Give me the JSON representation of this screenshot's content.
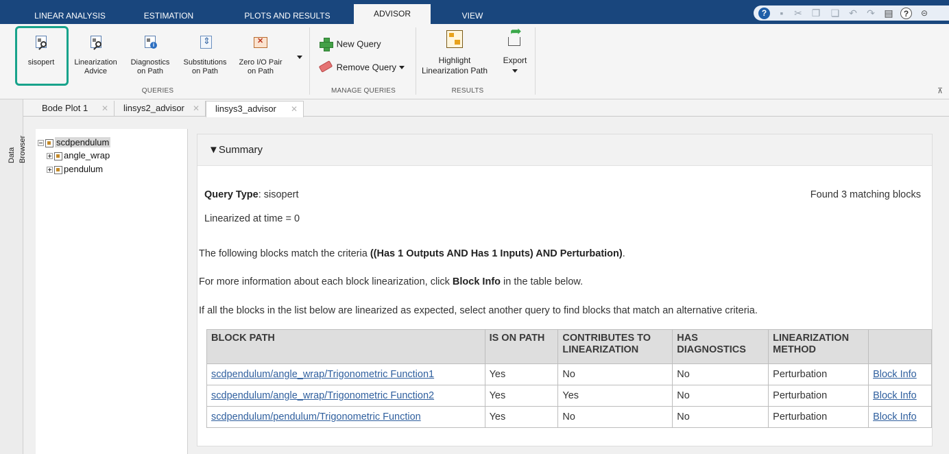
{
  "tabs": [
    {
      "label": "LINEAR ANALYSIS",
      "active": false
    },
    {
      "label": "ESTIMATION",
      "active": false
    },
    {
      "label": "PLOTS AND RESULTS",
      "active": false
    },
    {
      "label": "ADVISOR",
      "active": true
    },
    {
      "label": "VIEW",
      "active": false
    }
  ],
  "quick_access": [
    "help-icon",
    "save-icon",
    "cut-icon",
    "copy-icon",
    "paste-icon",
    "undo-icon",
    "redo-icon",
    "layout-icon",
    "help-icon",
    "minimize-icon"
  ],
  "ribbon": {
    "queries": {
      "buttons": [
        {
          "line1": "sisopert",
          "line2": ""
        },
        {
          "line1": "Linearization",
          "line2": "Advice"
        },
        {
          "line1": "Diagnostics",
          "line2": "on Path"
        },
        {
          "line1": "Substitutions",
          "line2": "on Path"
        },
        {
          "line1": "Zero I/O Pair",
          "line2": "on Path"
        }
      ],
      "group_label": "QUERIES"
    },
    "manage": {
      "new_query": "New Query",
      "remove_query": "Remove Query",
      "group_label": "MANAGE QUERIES"
    },
    "results": {
      "highlight_line1": "Highlight",
      "highlight_line2": "Linearization Path",
      "export": "Export",
      "group_label": "RESULTS"
    }
  },
  "side_panel_label": "Data Browser",
  "doc_tabs": [
    {
      "label": "Bode Plot 1",
      "active": false
    },
    {
      "label": "linsys2_advisor",
      "active": false
    },
    {
      "label": "linsys3_advisor",
      "active": true
    }
  ],
  "tree": [
    {
      "label": "scdpendulum",
      "expanded": true,
      "selected": true
    },
    {
      "label": "angle_wrap",
      "expanded": false,
      "selected": false
    },
    {
      "label": "pendulum",
      "expanded": false,
      "selected": false
    }
  ],
  "summary": {
    "header": "▼Summary",
    "query_type_label": "Query Type",
    "query_type_value": ": sisopert",
    "found": "Found 3 matching blocks",
    "linearized_at": "Linearized at time = 0",
    "criteria_prefix": "The following blocks match the criteria ",
    "criteria_bold": "((Has 1 Outputs AND Has 1 Inputs) AND Perturbation)",
    "criteria_suffix": ".",
    "info_prefix": "For more information about each block linearization, click ",
    "info_bold": "Block Info",
    "info_suffix": " in the table below.",
    "alt_text": "If all the blocks in the list below are linearized as expected, select another query to find blocks that match an alternative criteria."
  },
  "table": {
    "headers": [
      {
        "line1": "BLOCK PATH",
        "line2": ""
      },
      {
        "line1": "IS ON PATH",
        "line2": ""
      },
      {
        "line1": "CONTRIBUTES TO",
        "line2": "LINEARIZATION"
      },
      {
        "line1": "HAS",
        "line2": "DIAGNOSTICS"
      },
      {
        "line1": "LINEARIZATION",
        "line2": "METHOD"
      },
      {
        "line1": "",
        "line2": ""
      }
    ],
    "rows": [
      [
        "scdpendulum/angle_wrap/Trigonometric Function1",
        "Yes",
        "No",
        "No",
        "Perturbation",
        "Block Info"
      ],
      [
        "scdpendulum/angle_wrap/Trigonometric Function2",
        "Yes",
        "Yes",
        "No",
        "Perturbation",
        "Block Info"
      ],
      [
        "scdpendulum/pendulum/Trigonometric Function",
        "Yes",
        "No",
        "No",
        "Perturbation",
        "Block Info"
      ]
    ]
  },
  "colors": {
    "tabstrip_bg": "#19467d",
    "highlight_frame": "#18a38b",
    "link": "#2f5f9e"
  }
}
